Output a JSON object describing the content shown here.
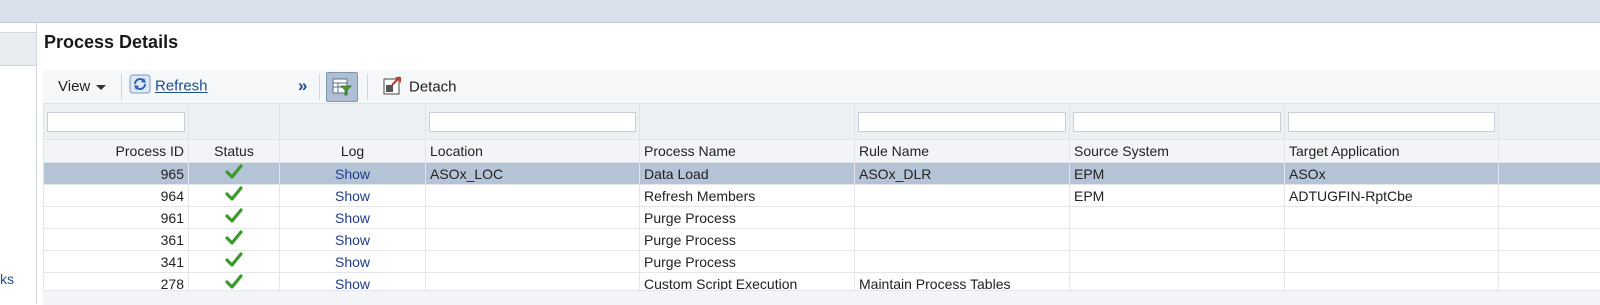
{
  "panel": {
    "title": "Process Details"
  },
  "sidebar": {
    "link_fragment": "ks"
  },
  "toolbar": {
    "view_label": "View",
    "refresh_label": "Refresh",
    "more_label": "»",
    "detach_label": "Detach"
  },
  "table": {
    "columns": [
      "Process ID",
      "Status",
      "Log",
      "Location",
      "Process Name",
      "Rule Name",
      "Source System",
      "Target Application"
    ],
    "rows": [
      {
        "id": "965",
        "status": "success-check-icon",
        "log": "Show",
        "location": "ASOx_LOC",
        "process": "Data Load",
        "rule": "ASOx_DLR",
        "source": "EPM",
        "target": "ASOx"
      },
      {
        "id": "964",
        "status": "success-check-icon",
        "log": "Show",
        "location": "",
        "process": "Refresh Members",
        "rule": "",
        "source": "EPM",
        "target": "ADTUGFIN-RptCbe"
      },
      {
        "id": "961",
        "status": "success-check-icon",
        "log": "Show",
        "location": "",
        "process": "Purge Process",
        "rule": "",
        "source": "",
        "target": ""
      },
      {
        "id": "361",
        "status": "success-check-icon",
        "log": "Show",
        "location": "",
        "process": "Purge Process",
        "rule": "",
        "source": "",
        "target": ""
      },
      {
        "id": "341",
        "status": "success-check-icon",
        "log": "Show",
        "location": "",
        "process": "Purge Process",
        "rule": "",
        "source": "",
        "target": ""
      },
      {
        "id": "278",
        "status": "success-check-icon",
        "log": "Show",
        "location": "",
        "process": "Custom Script Execution",
        "rule": "Maintain Process Tables",
        "source": "",
        "target": ""
      }
    ]
  },
  "colors": {
    "selected_row": "#b4c4d6",
    "link": "#1f3d8c",
    "check": "#3a9a2a"
  }
}
